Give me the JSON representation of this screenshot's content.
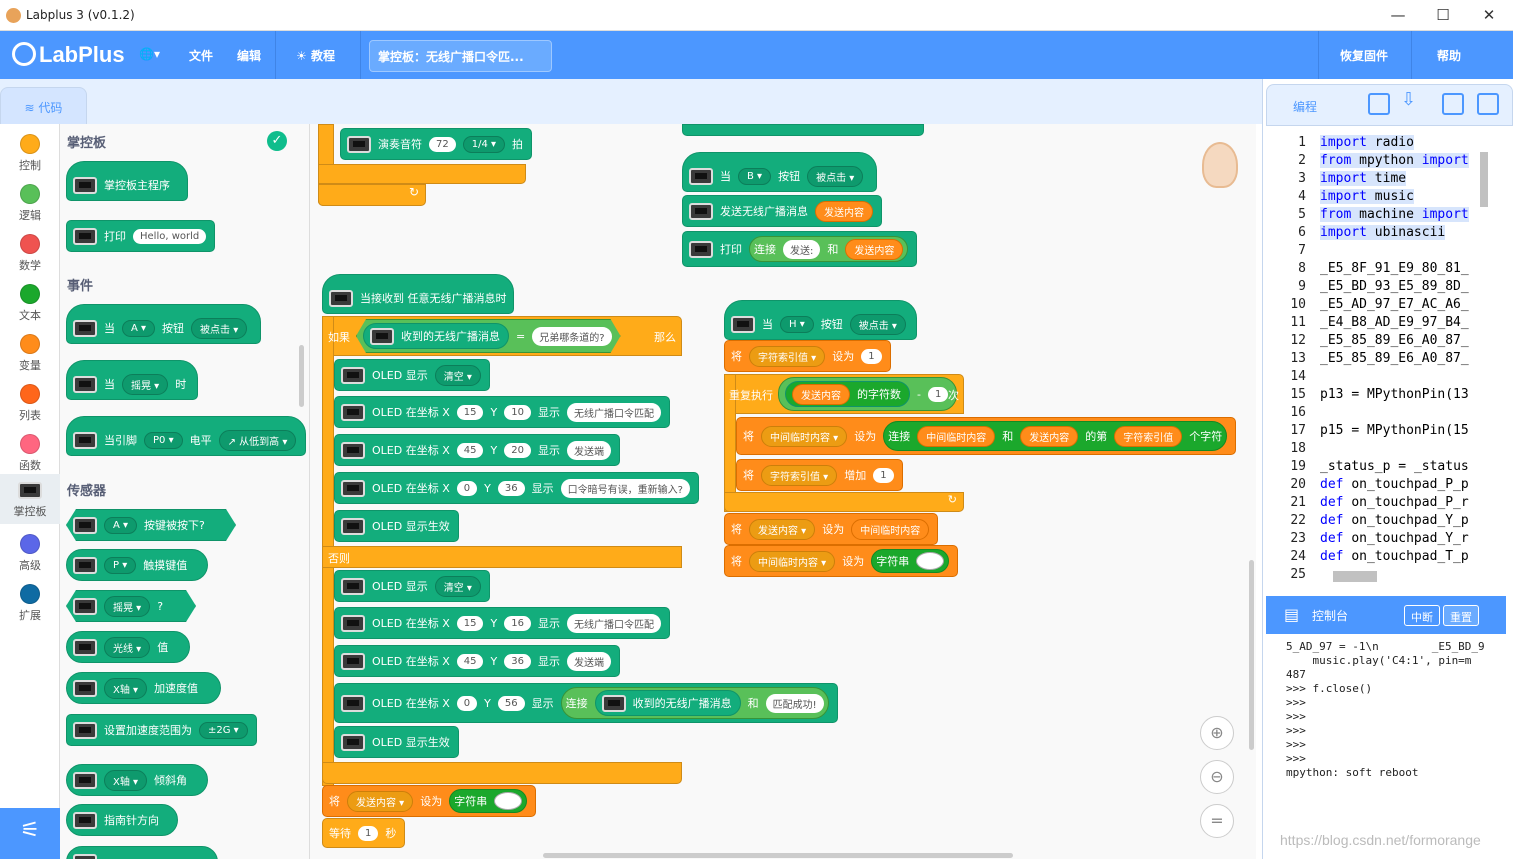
{
  "window": {
    "title": "Labplus 3 (v0.1.2)",
    "min": "—",
    "max": "☐",
    "close": "✕"
  },
  "menubar": {
    "brand": "LabPlus",
    "globe": "🌐▾",
    "file": "文件",
    "edit": "编辑",
    "tutorial": "教程",
    "project_title": "掌控板：无线广播口令匹...",
    "restore": "恢复固件",
    "help": "帮助"
  },
  "tabs": {
    "code": "代码",
    "programming": "编程"
  },
  "categories": [
    {
      "label": "控制",
      "color": "#ffab19"
    },
    {
      "label": "逻辑",
      "color": "#59c059"
    },
    {
      "label": "数学",
      "color": "#ef5350"
    },
    {
      "label": "文本",
      "color": "#1ba82c"
    },
    {
      "label": "变量",
      "color": "#ff8c1a"
    },
    {
      "label": "列表",
      "color": "#ff661a"
    },
    {
      "label": "函数",
      "color": "#ff6680"
    },
    {
      "label": "掌控板",
      "color": "#13ad7c"
    },
    {
      "label": "高级",
      "color": "#5b67e8"
    },
    {
      "label": "扩展",
      "color": "#0f6ba3"
    }
  ],
  "flyout": {
    "head1": "掌控板",
    "main": "掌控板主程序",
    "print": "打印",
    "print_arg": "Hello, world",
    "head2": "事件",
    "when": "当",
    "btnA": "A",
    "button": "按钮",
    "clicked": "被点击",
    "shake": "摇晃",
    "at": "时",
    "pin_when": "当引脚",
    "p0": "P0",
    "level": "电平",
    "rise": "↗ 从低到高",
    "head3": "传感器",
    "pressed": "按键被按下?",
    "p": "P",
    "touch": "触摸键值",
    "q": "?",
    "light": "光线",
    "value": "值",
    "xaxis": "X轴",
    "accel": "加速度值",
    "set_range": "设置加速度范围为",
    "g2": "±2G",
    "tilt": "倾斜角",
    "compass": "指南针方向"
  },
  "ws": {
    "play": "演奏音符",
    "note": "72",
    "beat": "1/4",
    "beat_unit": "拍",
    "when": "当",
    "b": "B",
    "button": "按钮",
    "clicked": "被点击",
    "send": "发送无线广播消息",
    "content": "发送内容",
    "print": "打印",
    "join": "连接",
    "sent": "发送:",
    "and": "和",
    "recv_any": "当接收到 任意无线广播消息时",
    "if": "如果",
    "recv": "收到的无线广播消息",
    "eq": "=",
    "secret": "兄弟哪条道的?",
    "then": "那么",
    "oled_show": "OLED 显示",
    "clear": "清空",
    "oled_at": "OLED 在坐标 X",
    "y": "Y",
    "show": "显示",
    "x15": "15",
    "y10": "10",
    "t1": "无线广播口令匹配",
    "x45": "45",
    "y20": "20",
    "t2": "发送端",
    "x0": "0",
    "y36": "36",
    "t3": "口令暗号有误，重新输入?",
    "oled_eff": "OLED 显示生效",
    "else": "否则",
    "y16": "16",
    "t4": "无线广播口令匹配",
    "y36b": "36",
    "y56": "56",
    "matched": "匹配成功!",
    "set": "将",
    "set_to": "设为",
    "str": "字符串",
    "wait": "等待",
    "one": "1",
    "sec": "秒",
    "h": "H",
    "idx": "字符索引值",
    "repeat": "重复执行",
    "len": "的字符数",
    "minus": "-",
    "times": "次",
    "tmp": "中间临时内容",
    "nth": "的第",
    "char": "个字符",
    "add": "增加"
  },
  "code": {
    "lines": [
      "import radio",
      "from mpython import",
      "import time",
      "import music",
      "from machine import",
      "import ubinascii",
      "",
      "_E5_8F_91_E9_80_81_",
      "_E5_BD_93_E5_89_8D_",
      "_E5_AD_97_E7_AC_A6_",
      "_E4_B8_AD_E9_97_B4_",
      "_E5_85_89_E6_A0_87_",
      "_E5_85_89_E6_A0_87_",
      "",
      "p13 = MPythonPin(13",
      "",
      "p15 = MPythonPin(15",
      "",
      "_status_p = _status",
      "def on_touchpad_P_p",
      "def on_touchpad_P_r",
      "def on_touchpad_Y_p",
      "def on_touchpad_Y_r",
      "def on_touchpad_T_p",
      ""
    ]
  },
  "console": {
    "title": "控制台",
    "interrupt": "中断",
    "reset": "重置",
    "lines": [
      "5_AD_97 = -1\\n        _E5_BD_9",
      "    music.play('C4:1', pin=m",
      "487",
      ">>> f.close()",
      ">>>",
      ">>>",
      ">>>",
      ">>>",
      ">>>",
      "mpython: soft reboot"
    ]
  },
  "watermark": "https://blog.csdn.net/formorange"
}
